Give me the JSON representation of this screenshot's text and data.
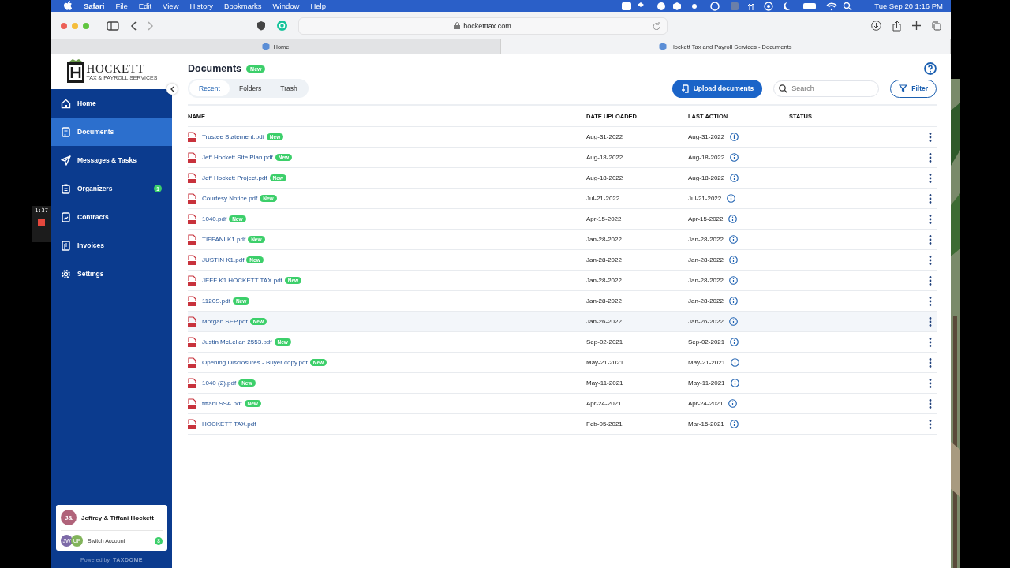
{
  "menubar": {
    "app": "Safari",
    "menus": [
      "File",
      "Edit",
      "View",
      "History",
      "Bookmarks",
      "Window",
      "Help"
    ],
    "clock": "Tue Sep 20  1:16 PM"
  },
  "browser": {
    "url": "hocketttax.com",
    "tabs": [
      {
        "title": "Home",
        "selected": false
      },
      {
        "title": "Hockett Tax and Payroll Services - Documents",
        "selected": true
      }
    ]
  },
  "logo": {
    "name": "HOCKETT",
    "subtitle": "TAX & PAYROLL SERVICES"
  },
  "sidebar": {
    "items": [
      {
        "label": "Home",
        "kind": "home",
        "selected": false
      },
      {
        "label": "Documents",
        "kind": "document",
        "selected": true
      },
      {
        "label": "Messages & Tasks",
        "kind": "send",
        "selected": false
      },
      {
        "label": "Organizers",
        "kind": "clipboard",
        "selected": false,
        "badge": "1"
      },
      {
        "label": "Contracts",
        "kind": "contract",
        "selected": false
      },
      {
        "label": "Invoices",
        "kind": "invoice",
        "selected": false
      },
      {
        "label": "Settings",
        "kind": "settings",
        "selected": false
      }
    ],
    "account": {
      "initials": "J&",
      "name": "Jeffrey & Tiffani Hockett",
      "switch_initials": [
        "JW",
        "UP"
      ],
      "switch_label": "Switch Account",
      "switch_badge": "8"
    },
    "powered_by": "Powered by",
    "powered_brand": "TAXDOME"
  },
  "recorder": {
    "time": "1:37"
  },
  "page": {
    "title": "Documents",
    "title_badge": "New",
    "tabs": [
      {
        "label": "Recent",
        "selected": true
      },
      {
        "label": "Folders",
        "selected": false
      },
      {
        "label": "Trash",
        "selected": false
      }
    ],
    "upload_button": "Upload documents",
    "search": {
      "placeholder": "Search"
    },
    "filter_button": "Filter"
  },
  "table": {
    "columns": [
      "NAME",
      "DATE UPLOADED",
      "LAST ACTION",
      "STATUS"
    ],
    "rows": [
      {
        "name": "Trustee Statement.pdf",
        "badge": "New",
        "uploaded": "Aug-31-2022",
        "last_action": "Aug-31-2022",
        "highlighted": false
      },
      {
        "name": "Jeff Hockett Site Plan.pdf",
        "badge": "New",
        "uploaded": "Aug-18-2022",
        "last_action": "Aug-18-2022",
        "highlighted": false
      },
      {
        "name": "Jeff Hockett Project.pdf",
        "badge": "New",
        "uploaded": "Aug-18-2022",
        "last_action": "Aug-18-2022",
        "highlighted": false
      },
      {
        "name": "Courtesy Notice.pdf",
        "badge": "New",
        "uploaded": "Jul-21-2022",
        "last_action": "Jul-21-2022",
        "highlighted": false
      },
      {
        "name": "1040.pdf",
        "badge": "New",
        "uploaded": "Apr-15-2022",
        "last_action": "Apr-15-2022",
        "highlighted": false
      },
      {
        "name": "TIFFANI K1.pdf",
        "badge": "New",
        "uploaded": "Jan-28-2022",
        "last_action": "Jan-28-2022",
        "highlighted": false
      },
      {
        "name": "JUSTIN K1.pdf",
        "badge": "New",
        "uploaded": "Jan-28-2022",
        "last_action": "Jan-28-2022",
        "highlighted": false
      },
      {
        "name": "JEFF K1 HOCKETT TAX.pdf",
        "badge": "New",
        "uploaded": "Jan-28-2022",
        "last_action": "Jan-28-2022",
        "highlighted": false
      },
      {
        "name": "1120S.pdf",
        "badge": "New",
        "uploaded": "Jan-28-2022",
        "last_action": "Jan-28-2022",
        "highlighted": false
      },
      {
        "name": "Morgan SEP.pdf",
        "badge": "New",
        "uploaded": "Jan-26-2022",
        "last_action": "Jan-26-2022",
        "highlighted": true
      },
      {
        "name": "Justin McLellan 2553.pdf",
        "badge": "New",
        "uploaded": "Sep-02-2021",
        "last_action": "Sep-02-2021",
        "highlighted": false
      },
      {
        "name": "Opening Disclosures - Buyer copy.pdf",
        "badge": "New",
        "uploaded": "May-21-2021",
        "last_action": "May-21-2021",
        "highlighted": false
      },
      {
        "name": "1040 (2).pdf",
        "badge": "New",
        "uploaded": "May-11-2021",
        "last_action": "May-11-2021",
        "highlighted": false
      },
      {
        "name": "tiffani SSA.pdf",
        "badge": "New",
        "uploaded": "Apr-24-2021",
        "last_action": "Apr-24-2021",
        "highlighted": false
      },
      {
        "name": "HOCKETT TAX.pdf",
        "uploaded": "Feb-05-2021",
        "last_action": "Mar-15-2021",
        "highlighted": false
      }
    ]
  }
}
